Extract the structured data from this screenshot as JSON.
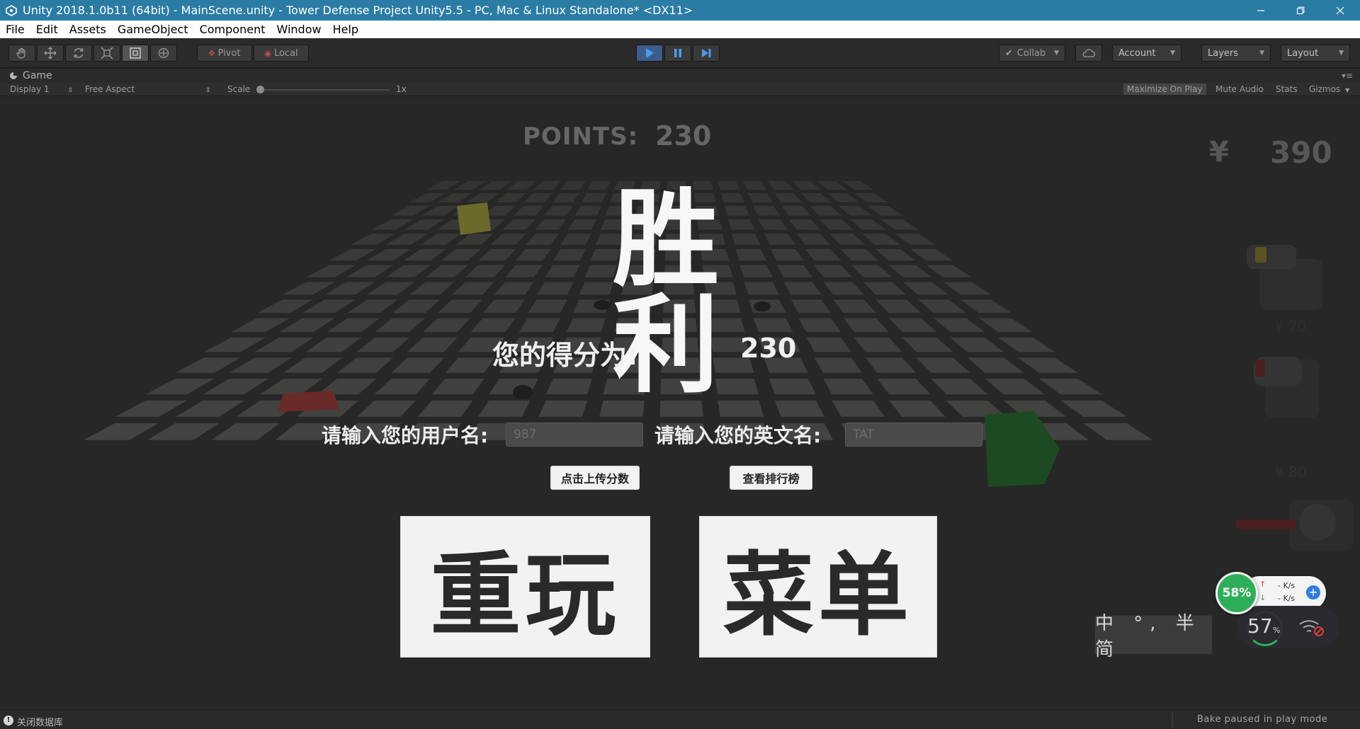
{
  "window": {
    "title": "Unity 2018.1.0b11 (64bit) - MainScene.unity - Tower Defense Project Unity5.5 - PC, Mac & Linux Standalone* <DX11>"
  },
  "menu": [
    "File",
    "Edit",
    "Assets",
    "GameObject",
    "Component",
    "Window",
    "Help"
  ],
  "toolbar": {
    "pivot_label": "Pivot",
    "local_label": "Local",
    "collab_label": "Collab",
    "account_label": "Account",
    "layers_label": "Layers",
    "layout_label": "Layout"
  },
  "game_tab": {
    "tab_label": "Game",
    "display_label": "Display 1",
    "aspect_label": "Free Aspect",
    "scale_label": "Scale",
    "scale_value": "1x",
    "maximize_label": "Maximize On Play",
    "mute_label": "Mute Audio",
    "stats_label": "Stats",
    "gizmos_label": "Gizmos"
  },
  "hud": {
    "points_label": "POINTS:",
    "points_value": "230",
    "currency_symbol": "¥",
    "money_value": "390"
  },
  "victory": {
    "title": "胜 利",
    "score_label": "您的得分为:",
    "score_value": "230",
    "username_label": "请输入您的用户名:",
    "username_value": "987",
    "english_name_label": "请输入您的英文名:",
    "english_name_value": "TAT",
    "upload_button": "点击上传分数",
    "leaderboard_button": "查看排行榜",
    "replay_button": "重玩",
    "menu_button": "菜单"
  },
  "overlay": {
    "cpu_percent": "58%",
    "upload_speed": "- K/s",
    "download_speed": "- K/s",
    "memory_value": "57",
    "memory_unit": "%",
    "ime_text": "中 °, 半 简"
  },
  "status": {
    "message": "关闭数据库",
    "bake_status": "Bake paused in play mode"
  },
  "colors": {
    "titlebar": "#2b7ca4",
    "cpu_green": "#2fae5a",
    "play_blue": "#3c5c8a"
  }
}
